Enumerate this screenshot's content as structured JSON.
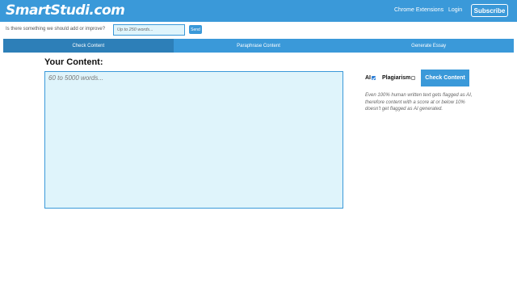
{
  "header": {
    "logo": "SmartStudi.com",
    "nav": {
      "chrome_extensions": "Chrome Extensions",
      "login": "Login",
      "subscribe": "Subscribe"
    }
  },
  "feedback": {
    "question": "Is there something we should add or improve?",
    "placeholder": "Up to 250 words...",
    "value": "",
    "send_label": "Send"
  },
  "tabs": [
    {
      "label": "Check Content",
      "active": true
    },
    {
      "label": "Paraphrase Content",
      "active": false
    },
    {
      "label": "Generate Essay",
      "active": false
    }
  ],
  "main": {
    "heading": "Your Content:",
    "content_placeholder": "60 to 5000 words...",
    "content_value": ""
  },
  "options": {
    "ai_label": "AI",
    "ai_checked": true,
    "plagiarism_label": "Plagiarism",
    "plagiarism_checked": false,
    "check_button": "Check Content",
    "note": "Even 100% human written text gets flagged as AI, therefore content with a score at or below 10% doesn't get flagged as AI generated."
  },
  "colors": {
    "primary": "#3a99d9",
    "active_tab": "#2d7fb8",
    "input_bg": "#dff4fb"
  }
}
